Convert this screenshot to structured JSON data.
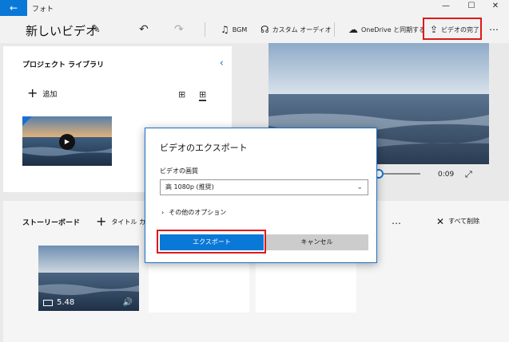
{
  "app": {
    "title": "フォト",
    "back_icon": "back-arrow-icon",
    "window_controls": {
      "minimize": "—",
      "maximize": "☐",
      "close": "✕"
    }
  },
  "toolbar": {
    "project_name": "新しいビデオ",
    "bgm_label": "BGM",
    "custom_audio_label": "カスタム オーディオ",
    "onedrive_label": "OneDrive と同期する",
    "finish_video_label": "ビデオの完了",
    "more": "…"
  },
  "library": {
    "title": "プロジェクト ライブラリ",
    "add_label": "追加"
  },
  "preview": {
    "time": "0:09"
  },
  "storyboard": {
    "title": "ストーリーボード",
    "add_title_card_label": "タイトル カードの",
    "more": "…",
    "delete_all_label": "すべて削除",
    "clips": [
      {
        "duration": "5.48"
      }
    ]
  },
  "export_dialog": {
    "title": "ビデオのエクスポート",
    "quality_label": "ビデオの画質",
    "quality_value": "高 1080p (推奨)",
    "more_options_label": "その他のオプション",
    "export_button": "エクスポート",
    "cancel_button": "キャンセル"
  },
  "colors": {
    "accent": "#0a78d7",
    "highlight": "#e01818"
  }
}
